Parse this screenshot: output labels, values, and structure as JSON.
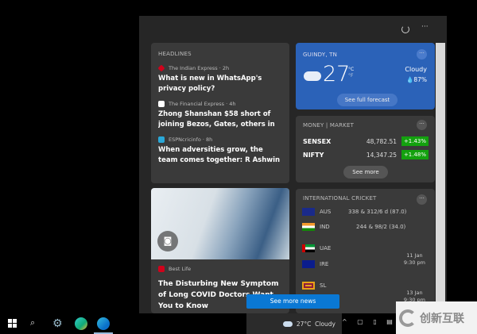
{
  "headlines": {
    "title": "HEADLINES",
    "items": [
      {
        "source": "The Indian Express · 2h",
        "title": "What is new in WhatsApp's privacy policy?",
        "color": "#d0021b"
      },
      {
        "source": "The Financial Express · 4h",
        "title": "Zhong Shanshan $58 short of joining Bezos, Gates, others in $100B wealth ...",
        "color": "#3a6fc0"
      },
      {
        "source": "ESPNcricinfo · 8h",
        "title": "When adversities grow, the team comes together: R Ashwin",
        "color": "#2aa8d8"
      }
    ]
  },
  "weather": {
    "location": "GUINDY, TN",
    "temp": "27",
    "unit_c": "°C",
    "unit_f": "°F",
    "condition": "Cloudy",
    "humidity": "87%",
    "forecast_label": "See full forecast",
    "color": "#2b62b8"
  },
  "market": {
    "title": "MONEY | MARKET",
    "rows": [
      {
        "name": "SENSEX",
        "value": "48,782.51",
        "change": "+1.43%"
      },
      {
        "name": "NIFTY",
        "value": "14,347.25",
        "change": "+1.48%"
      }
    ],
    "see_more": "See more",
    "up_color": "#13a10e"
  },
  "story": {
    "source": "Best Life",
    "title": "The Disturbing New Symptom of Long COVID Doctors Want You to Know"
  },
  "cricket": {
    "title": "INTERNATIONAL CRICKET",
    "teams": [
      {
        "name": "AUS",
        "score": "338 & 312/6 d (87.0)"
      },
      {
        "name": "IND",
        "score": "244 & 98/2 (34.0)"
      },
      {
        "name": "UAE"
      },
      {
        "name": "IRE"
      },
      {
        "name": "SL"
      }
    ],
    "match2_time": [
      "11 Jan",
      "9:30 pm"
    ],
    "match3_time": [
      "13 Jan",
      "9:30 pm"
    ]
  },
  "see_more_news": "See more news",
  "taskbar": {
    "weather": "27°C  Cloudy"
  },
  "watermark": "创新互联"
}
